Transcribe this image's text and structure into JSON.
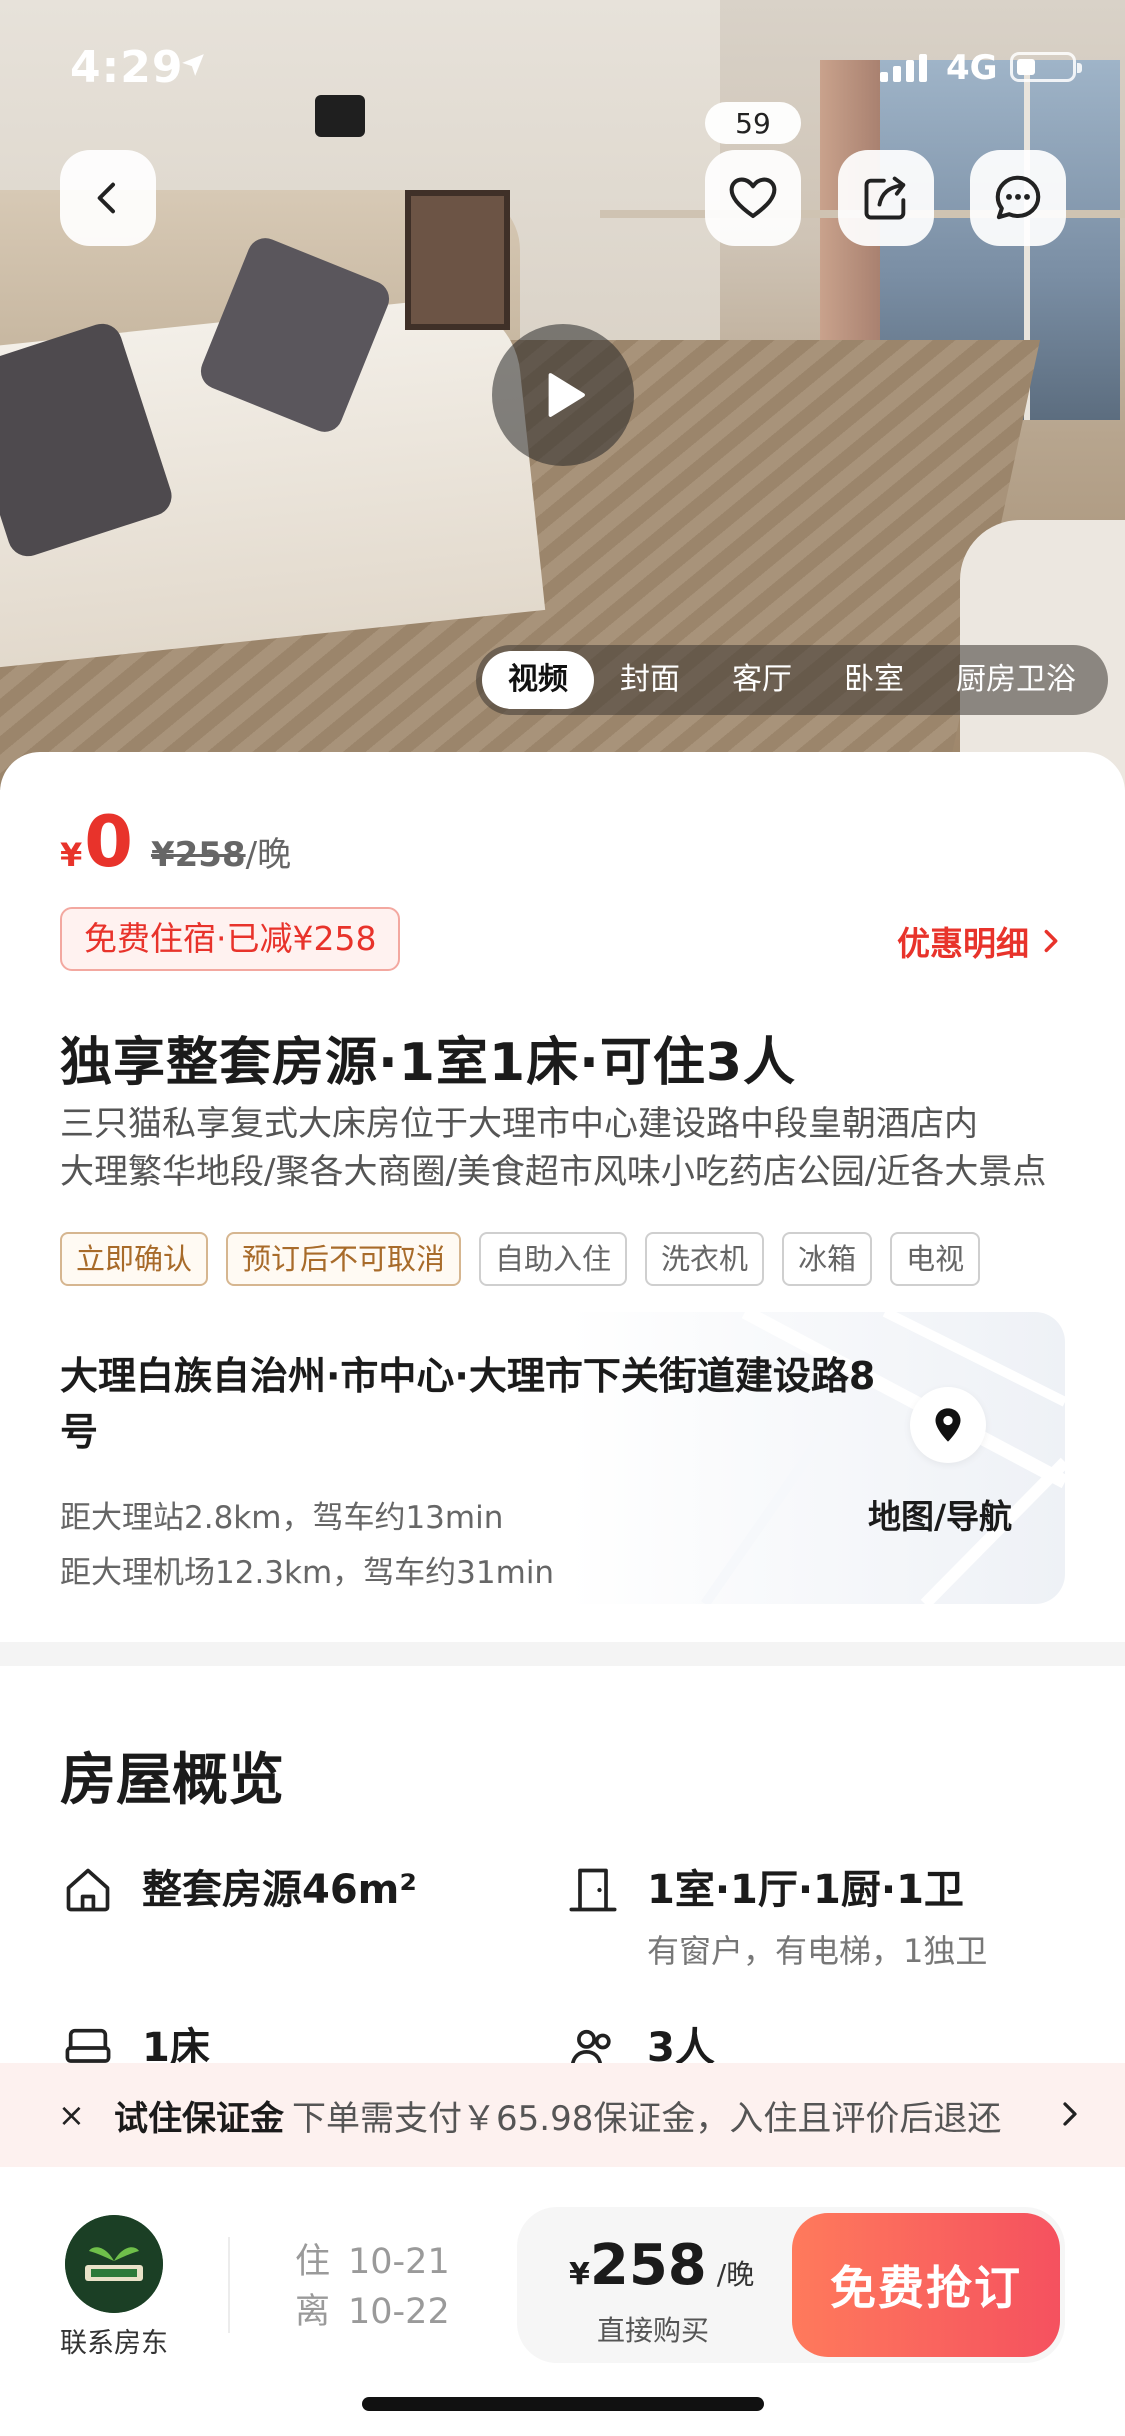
{
  "status_bar": {
    "time": "4:29",
    "network": "4G"
  },
  "hero": {
    "favorite_count": "59",
    "media_tabs": [
      {
        "label": "视频",
        "active": true
      },
      {
        "label": "封面",
        "active": false
      },
      {
        "label": "客厅",
        "active": false
      },
      {
        "label": "卧室",
        "active": false
      },
      {
        "label": "厨房卫浴",
        "active": false
      }
    ],
    "icons": {
      "back": "chevron-left-icon",
      "favorite": "heart-icon",
      "share": "share-icon",
      "message": "chat-icon",
      "play": "play-icon"
    }
  },
  "price": {
    "currency": "¥",
    "current": "0",
    "original": "¥258",
    "unit": "/晚",
    "free_tag": "免费住宿·已减¥258",
    "discount_link": "优惠明细"
  },
  "listing": {
    "title": "独享整套房源·1室1床·可住3人",
    "desc_line1": "三只猫私享复式大床房位于大理市中心建设路中段皇朝酒店内",
    "desc_line2": "大理繁华地段/聚各大商圈/美食超市风味小吃药店公园/近各大景点",
    "tags": [
      {
        "label": "立即确认",
        "style": "warm"
      },
      {
        "label": "预订后不可取消",
        "style": "warm"
      },
      {
        "label": "自助入住",
        "style": "plain"
      },
      {
        "label": "洗衣机",
        "style": "plain"
      },
      {
        "label": "冰箱",
        "style": "plain"
      },
      {
        "label": "电视",
        "style": "plain"
      }
    ]
  },
  "address": {
    "title": "大理白族自治州·市中心·大理市下关街道建设路8号",
    "line1": "距大理站2.8km，驾车约13min",
    "line2": "距大理机场12.3km，驾车约31min",
    "map_label": "地图/导航"
  },
  "overview": {
    "title": "房屋概览",
    "items": [
      {
        "icon": "house-icon",
        "main": "整套房源46m²",
        "sub": ""
      },
      {
        "icon": "door-icon",
        "main": "1室·1厅·1厨·1卫",
        "sub": "有窗户，有电梯，1独卫"
      },
      {
        "icon": "bed-icon",
        "main": "1床",
        "sub": ""
      },
      {
        "icon": "people-icon",
        "main": "3人",
        "sub": ""
      }
    ]
  },
  "deposit": {
    "close": "×",
    "strong": "试住保证金",
    "text": "下单需支付￥65.98保证金，入住且评价后退还"
  },
  "bottom": {
    "host_label": "联系房东",
    "checkin_key": "住",
    "checkin": "10-21",
    "checkout_key": "离",
    "checkout": "10-22",
    "currency": "¥",
    "price": "258",
    "unit": "/晚",
    "buy_sub": "直接购买",
    "cta": "免费抢订"
  },
  "colors": {
    "accent_red": "#e8332b",
    "cta_start": "#ff7a5c",
    "cta_end": "#f5515f",
    "warm_tag": "#a86b2a"
  }
}
